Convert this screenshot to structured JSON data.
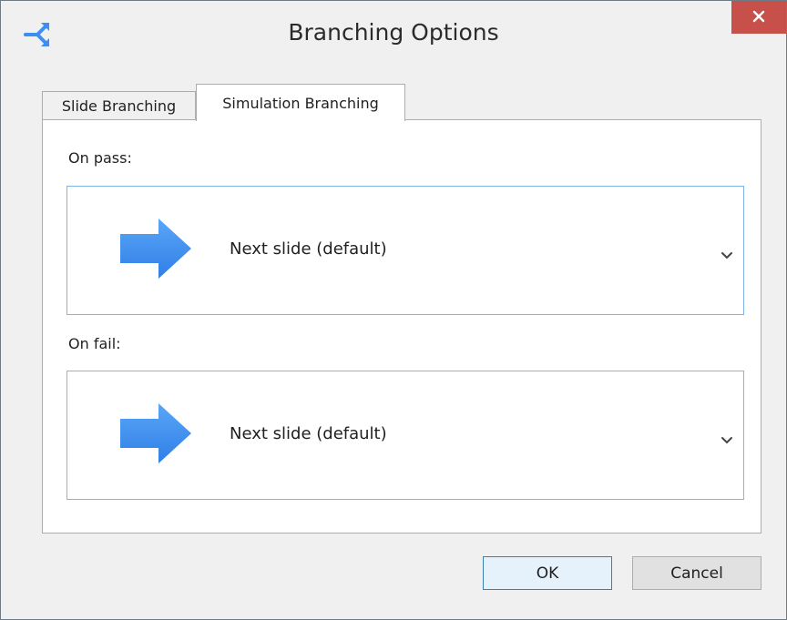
{
  "window": {
    "title": "Branching Options",
    "app_icon": "branching-icon",
    "close_icon": "close-icon"
  },
  "tabs": [
    {
      "label": "Slide Branching",
      "active": false
    },
    {
      "label": "Simulation Branching",
      "active": true
    }
  ],
  "on_pass": {
    "label": "On pass:",
    "value": "Next slide (default)",
    "icon": "right-arrow-icon"
  },
  "on_fail": {
    "label": "On fail:",
    "value": "Next slide (default)",
    "icon": "right-arrow-icon"
  },
  "buttons": {
    "ok": "OK",
    "cancel": "Cancel"
  },
  "colors": {
    "accent_arrow": "#3d8ef2",
    "close_button": "#c7504b",
    "focus_border": "#7eb4ea"
  }
}
